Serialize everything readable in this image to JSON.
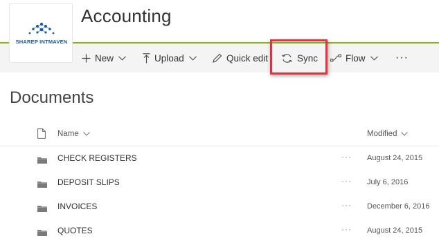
{
  "site": {
    "title": "Accounting",
    "logo_text": "SHAREP INTMAVEN"
  },
  "command_bar": {
    "new_label": "New",
    "upload_label": "Upload",
    "quick_edit_label": "Quick edit",
    "sync_label": "Sync",
    "flow_label": "Flow",
    "more_label": "···"
  },
  "library": {
    "title": "Documents",
    "columns": {
      "name": "Name",
      "modified": "Modified"
    },
    "row_actions_label": "···",
    "items": [
      {
        "name": "CHECK REGISTERS",
        "modified": "August 24, 2015"
      },
      {
        "name": "DEPOSIT SLIPS",
        "modified": "July 6, 2016"
      },
      {
        "name": "INVOICES",
        "modified": "December 6, 2016"
      },
      {
        "name": "QUOTES",
        "modified": "August 24, 2015"
      }
    ]
  },
  "colors": {
    "suite_accent": "#7fba00",
    "highlight": "#e5303d",
    "logo_blue": "#1a5aa6"
  },
  "icons": {
    "new": "plus-icon",
    "upload": "upload-arrow-icon",
    "quick_edit": "pencil-icon",
    "sync": "sync-icon",
    "flow": "flow-icon",
    "folder": "folder-icon",
    "file": "file-icon"
  }
}
